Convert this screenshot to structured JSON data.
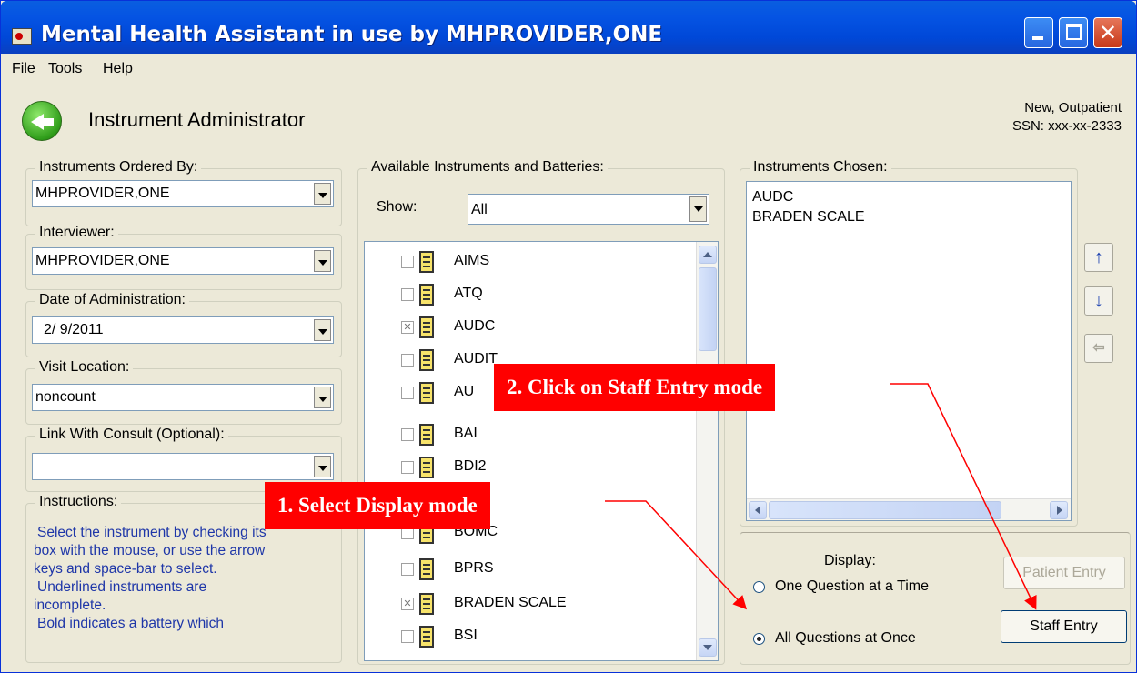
{
  "window": {
    "title": "Mental Health Assistant in use by MHPROVIDER,ONE"
  },
  "menubar": {
    "file": "File",
    "tools": "Tools",
    "help": "Help"
  },
  "header": {
    "title": "Instrument Administrator",
    "patient_status": "New, Outpatient",
    "ssn": "SSN: xxx-xx-2333"
  },
  "left": {
    "ordered_by": {
      "label": "Instruments Ordered By:",
      "value": "MHPROVIDER,ONE"
    },
    "interviewer": {
      "label": "Interviewer:",
      "value": "MHPROVIDER,ONE"
    },
    "date": {
      "label": "Date of Administration:",
      "value": "2/ 9/2011"
    },
    "location": {
      "label": "Visit Location:",
      "value": "noncount"
    },
    "consult": {
      "label": "Link With Consult (Optional):",
      "value": ""
    },
    "instructions": {
      "label": "Instructions:",
      "lines": [
        "Select the instrument by checking its",
        "box with the mouse, or use the arrow",
        "keys and space-bar to select.",
        "Underlined instruments are",
        "incomplete.",
        "Bold indicates a battery which"
      ]
    }
  },
  "available": {
    "label": "Available Instruments and Batteries:",
    "show_label": "Show:",
    "show_value": "All",
    "items": [
      {
        "name": "AIMS",
        "checked": false
      },
      {
        "name": "ATQ",
        "checked": false
      },
      {
        "name": "AUDC",
        "checked": true
      },
      {
        "name": "AUDIT",
        "checked": false
      },
      {
        "name": "AU",
        "checked": false
      },
      {
        "name": "BAI",
        "checked": false
      },
      {
        "name": "BDI2",
        "checked": false
      },
      {
        "name": "",
        "checked": false
      },
      {
        "name": "BOMC",
        "checked": false
      },
      {
        "name": "BPRS",
        "checked": false
      },
      {
        "name": "BRADEN SCALE",
        "checked": true
      },
      {
        "name": "BSI",
        "checked": false
      }
    ]
  },
  "chosen": {
    "label": "Instruments Chosen:",
    "items": [
      "AUDC",
      "BRADEN SCALE"
    ]
  },
  "display": {
    "label": "Display:",
    "one": "One Question at a Time",
    "all": "All Questions at Once",
    "selected": "all"
  },
  "buttons": {
    "patient_entry": "Patient Entry",
    "staff_entry": "Staff Entry"
  },
  "callouts": {
    "step1": "1. Select Display mode",
    "step2": "2. Click on Staff Entry mode"
  },
  "colors": {
    "callout": "#ff0000",
    "title_bar": "#0054e3",
    "instructions_text": "#1e36a8"
  }
}
